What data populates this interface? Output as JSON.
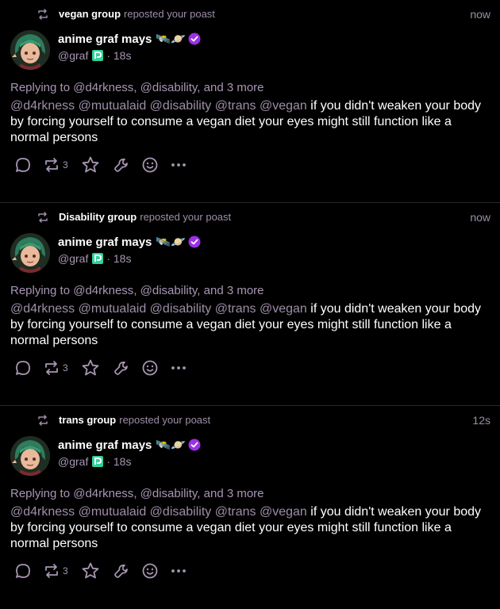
{
  "notifications": [
    {
      "group": "vegan group",
      "action_text": "reposted your poast",
      "time": "now",
      "author": {
        "name": "anime graf mays",
        "emoji": "🛰️🪐",
        "handle": "@graf",
        "age": "· 18s"
      },
      "replying_prefix": "Replying to",
      "replying_mentions": [
        "@d4rkness",
        "@disability"
      ],
      "replying_more": "and 3 more",
      "mentions": "@d4rkness @mutualaid @disability @trans @vegan",
      "text": "if you didn't weaken your body by forcing yourself to consume a vegan diet your eyes might still function like a normal persons",
      "repost_count": "3"
    },
    {
      "group": "Disability group",
      "action_text": "reposted your poast",
      "time": "now",
      "author": {
        "name": "anime graf mays",
        "emoji": "🛰️🪐",
        "handle": "@graf",
        "age": "· 18s"
      },
      "replying_prefix": "Replying to",
      "replying_mentions": [
        "@d4rkness",
        "@disability"
      ],
      "replying_more": "and 3 more",
      "mentions": "@d4rkness @mutualaid @disability @trans @vegan",
      "text": "if you didn't weaken your body by forcing yourself to consume a vegan diet your eyes might still function like a normal persons",
      "repost_count": "3"
    },
    {
      "group": "trans group",
      "action_text": "reposted your poast",
      "time": "12s",
      "author": {
        "name": "anime graf mays",
        "emoji": "🛰️🪐",
        "handle": "@graf",
        "age": "· 18s"
      },
      "replying_prefix": "Replying to",
      "replying_mentions": [
        "@d4rkness",
        "@disability"
      ],
      "replying_more": "and 3 more",
      "mentions": "@d4rkness @mutualaid @disability @trans @vegan",
      "text": "if you didn't weaken your body by forcing yourself to consume a vegan diet your eyes might still function like a normal persons",
      "repost_count": "3"
    }
  ],
  "icons": [
    "repost-icon",
    "verified-icon",
    "p-badge-icon",
    "reply-icon",
    "star-icon",
    "wrench-icon",
    "emoji-icon",
    "more-icon"
  ],
  "colors": {
    "muted": "#a896b4",
    "verified": "#9b30e6",
    "badge": "#2fd39a"
  }
}
